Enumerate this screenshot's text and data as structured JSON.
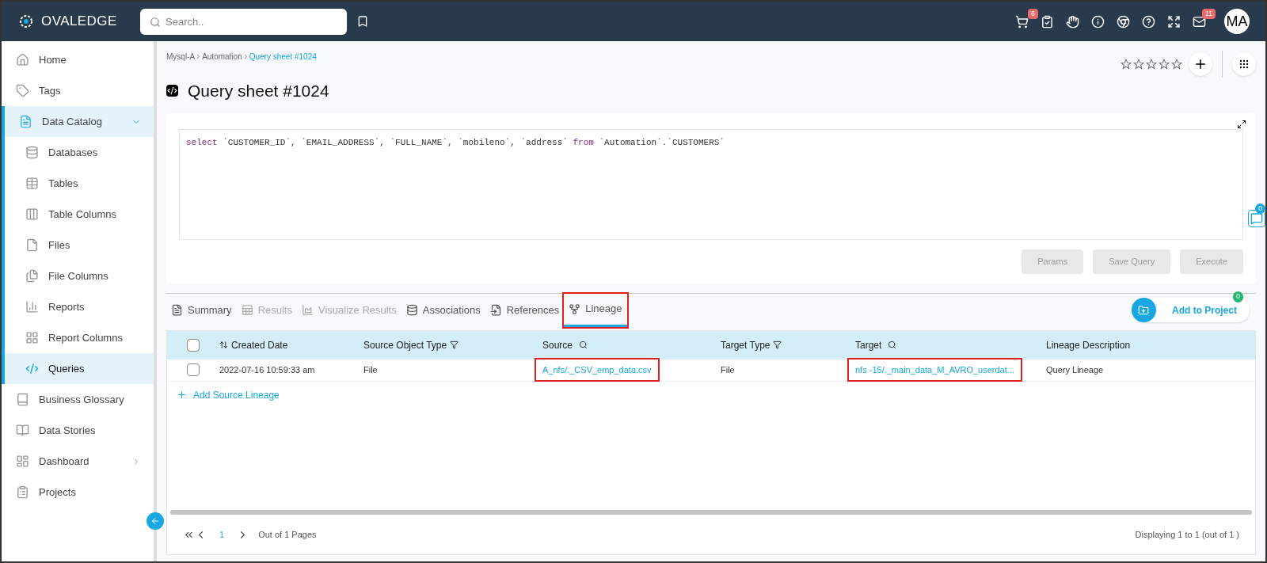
{
  "header": {
    "logo": "OVALEDGE",
    "search": {
      "placeholder": "Search.."
    },
    "cart_badge": "6",
    "mail_badge": "11",
    "avatar": "MA"
  },
  "sidebar": {
    "items": [
      {
        "label": "Home",
        "kind": "home",
        "selected": false
      },
      {
        "label": "Tags",
        "kind": "tag",
        "selected": false
      },
      {
        "label": "Data Catalog",
        "kind": "catalog",
        "selected": false,
        "expanded": true,
        "children": [
          {
            "label": "Databases",
            "kind": "database",
            "selected": false
          },
          {
            "label": "Tables",
            "kind": "table",
            "selected": false
          },
          {
            "label": "Table Columns",
            "kind": "columns",
            "selected": false
          },
          {
            "label": "Files",
            "kind": "file",
            "selected": false
          },
          {
            "label": "File Columns",
            "kind": "files",
            "selected": false
          },
          {
            "label": "Reports",
            "kind": "report",
            "selected": false
          },
          {
            "label": "Report Columns",
            "kind": "reportcols",
            "selected": false
          },
          {
            "label": "Queries",
            "kind": "query",
            "selected": true
          }
        ]
      },
      {
        "label": "Business Glossary",
        "kind": "book",
        "selected": false
      },
      {
        "label": "Data Stories",
        "kind": "stories",
        "selected": false
      },
      {
        "label": "Dashboard",
        "kind": "dashboard",
        "selected": false,
        "expanded": false
      },
      {
        "label": "Projects",
        "kind": "projects",
        "selected": false
      }
    ]
  },
  "breadcrumb": [
    "Mysql-A",
    "Automation",
    "Query sheet #1024"
  ],
  "title": "Query sheet #1024",
  "stars": 0,
  "query": {
    "keyword1": "select",
    "columns": "`CUSTOMER_ID`, `EMAIL_ADDRESS`, `FULL_NAME`, `mobileno`, `address`",
    "keyword2": "from",
    "table": "`Automation`.`CUSTOMERS`"
  },
  "comment_badge": "0",
  "query_buttons": [
    {
      "label": "Params",
      "disabled": true
    },
    {
      "label": "Save Query",
      "disabled": true
    },
    {
      "label": "Execute",
      "disabled": true
    }
  ],
  "tabs": [
    {
      "label": "Summary",
      "kind": "summary",
      "selected": false,
      "disabled": false,
      "highlighted": false
    },
    {
      "label": "Results",
      "kind": "results",
      "selected": false,
      "disabled": true,
      "highlighted": false
    },
    {
      "label": "Visualize Results",
      "kind": "chart",
      "selected": false,
      "disabled": true,
      "highlighted": false
    },
    {
      "label": "Associations",
      "kind": "database",
      "selected": false,
      "disabled": false,
      "highlighted": false
    },
    {
      "label": "References",
      "kind": "references",
      "selected": false,
      "disabled": false,
      "highlighted": false
    },
    {
      "label": "Lineage",
      "kind": "lineage",
      "selected": true,
      "disabled": false,
      "highlighted": true
    }
  ],
  "add_to_project": {
    "label": "Add to Project",
    "badge": "0"
  },
  "table": {
    "select_all": {
      "checked": false
    },
    "columns": [
      {
        "label": "Created Date",
        "kind": "sort"
      },
      {
        "label": "Source Object Type",
        "kind": "filter"
      },
      {
        "label": "Source",
        "kind": "search"
      },
      {
        "label": "Target Type",
        "kind": "filter"
      },
      {
        "label": "Target",
        "kind": "search"
      },
      {
        "label": "Lineage Description",
        "kind": "plain"
      }
    ],
    "rows": [
      {
        "checked": false,
        "cells": [
          {
            "text": "2022-07-16 10:59:33 am",
            "link": false,
            "highlighted": false
          },
          {
            "text": "File",
            "link": false,
            "highlighted": false
          },
          {
            "text": "A_nfs/._CSV_emp_data.csv",
            "link": true,
            "highlighted": true
          },
          {
            "text": "File",
            "link": false,
            "highlighted": false
          },
          {
            "text": "nfs -15/._main_data_M_AVRO_userdat...",
            "link": true,
            "highlighted": true
          },
          {
            "text": "Query Lineage",
            "link": false,
            "highlighted": false
          }
        ]
      }
    ]
  },
  "add_source_lineage": "Add Source Lineage",
  "pagination": {
    "page": "1",
    "pages_text": "Out of 1 Pages",
    "display_text": "Displaying 1 to 1 (out of 1 )"
  }
}
